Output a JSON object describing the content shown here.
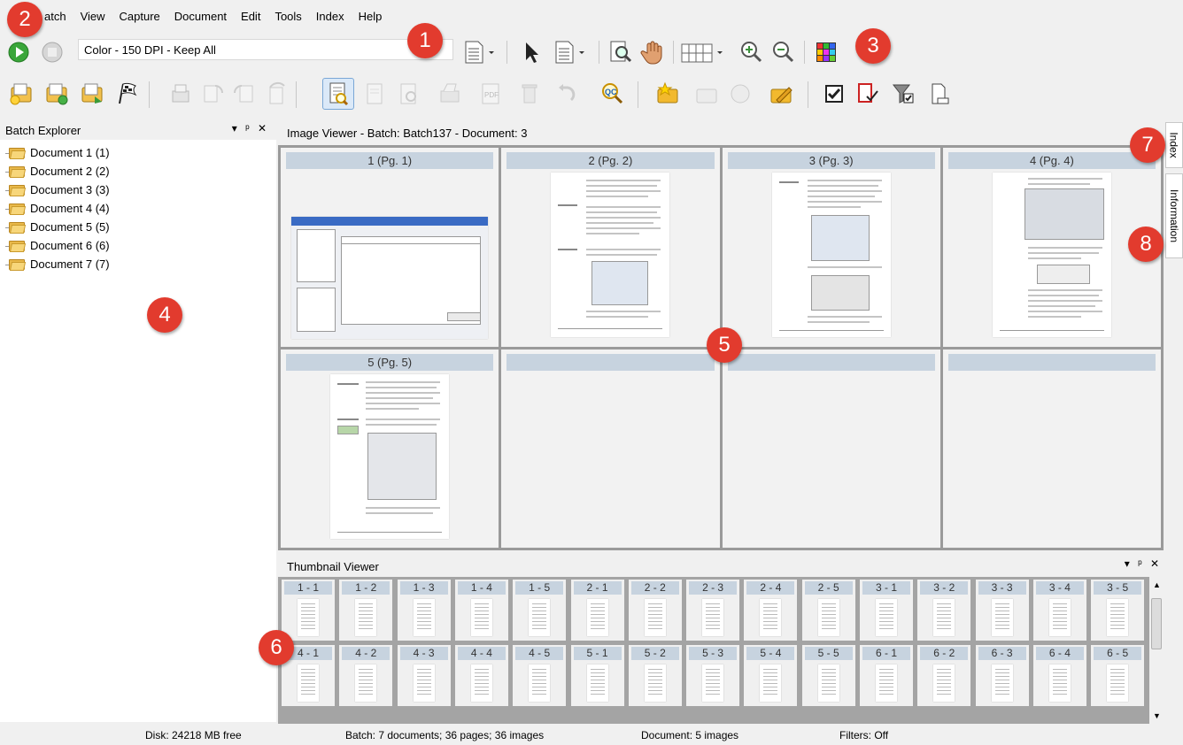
{
  "menu": [
    "atch",
    "View",
    "Capture",
    "Document",
    "Edit",
    "Tools",
    "Index",
    "Help"
  ],
  "toolbar": {
    "profile": "Color - 150 DPI - Keep All"
  },
  "batch_explorer": {
    "title": "Batch Explorer",
    "controls": "▾ ᵖ ✕",
    "documents": [
      "Document 1 (1)",
      "Document 2 (2)",
      "Document 3 (3)",
      "Document 4 (4)",
      "Document 5 (5)",
      "Document 6 (6)",
      "Document 7 (7)"
    ]
  },
  "image_viewer": {
    "title": "Image Viewer - Batch: Batch137 - Document: 3",
    "cells": [
      "1 (Pg. 1)",
      "2 (Pg. 2)",
      "3 (Pg. 3)",
      "4 (Pg. 4)",
      "5 (Pg. 5)",
      "",
      "",
      ""
    ]
  },
  "side_tabs": {
    "index": "Index",
    "information": "Information"
  },
  "thumbnail_viewer": {
    "title": "Thumbnail Viewer",
    "controls": "▾ ᵖ ✕",
    "row1": [
      "1 - 1",
      "1 - 2",
      "1 - 3",
      "1 - 4",
      "1 - 5",
      "2 - 1",
      "2 - 2",
      "2 - 3",
      "2 - 4",
      "2 - 5",
      "3 - 1",
      "3 - 2",
      "3 - 3",
      "3 - 4",
      "3 - 5"
    ],
    "row2": [
      "4 - 1",
      "4 - 2",
      "4 - 3",
      "4 - 4",
      "4 - 5",
      "5 - 1",
      "5 - 2",
      "5 - 3",
      "5 - 4",
      "5 - 5",
      "6 - 1",
      "6 - 2",
      "6 - 3",
      "6 - 4",
      "6 - 5"
    ]
  },
  "status": {
    "disk": "Disk: 24218 MB free",
    "batch": "Batch: 7 documents; 36 pages; 36 images",
    "document": "Document: 5 images",
    "filters": "Filters: Off"
  },
  "badges": [
    "1",
    "2",
    "3",
    "4",
    "5",
    "6",
    "7",
    "8"
  ],
  "colors": {
    "badge": "#e23b2e",
    "label_bg": "#c7d3df",
    "accent_green": "#3aa63a"
  }
}
